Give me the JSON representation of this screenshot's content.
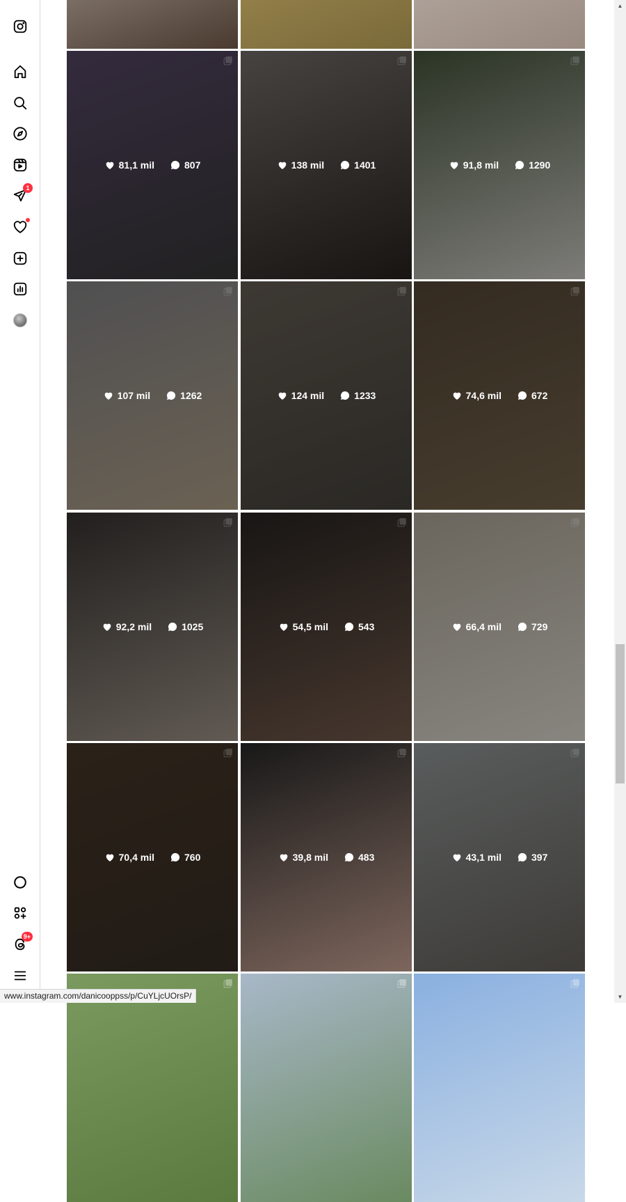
{
  "sidebar": {
    "items": [
      {
        "name": "instagram-logo-icon"
      },
      {
        "name": "home-icon"
      },
      {
        "name": "search-icon"
      },
      {
        "name": "explore-compass-icon"
      },
      {
        "name": "reels-icon"
      },
      {
        "name": "messages-icon",
        "badge": "1"
      },
      {
        "name": "notifications-heart-icon",
        "dot": true
      },
      {
        "name": "create-plus-icon"
      },
      {
        "name": "dashboard-icon"
      },
      {
        "name": "profile-avatar"
      },
      {
        "name": "meta-ai-icon"
      },
      {
        "name": "also-from-meta-icon"
      },
      {
        "name": "threads-icon",
        "badge": "9+"
      },
      {
        "name": "more-menu-icon"
      }
    ],
    "accent_color": "#ff3040"
  },
  "posts": [
    {
      "likes": "",
      "comments": "",
      "colors": [
        "#c9c2b8",
        "#4a3a30"
      ]
    },
    {
      "likes": "",
      "comments": "",
      "colors": [
        "#b8a060",
        "#7a6a3a"
      ]
    },
    {
      "likes": "",
      "comments": "",
      "colors": [
        "#c8c4be",
        "#9a8a80"
      ]
    },
    {
      "likes": "81,1 mil",
      "comments": "807",
      "colors": [
        "#5a4a6a",
        "#3a3a3a"
      ]
    },
    {
      "likes": "138 mil",
      "comments": "1401",
      "colors": [
        "#7a7470",
        "#2a2420"
      ]
    },
    {
      "likes": "91,8 mil",
      "comments": "1290",
      "colors": [
        "#4a5a40",
        "#d8d6d0"
      ]
    },
    {
      "likes": "107 mil",
      "comments": "1262",
      "colors": [
        "#8a8a8c",
        "#b8a890"
      ]
    },
    {
      "likes": "124 mil",
      "comments": "1233",
      "colors": [
        "#6a6258",
        "#4a4640"
      ]
    },
    {
      "likes": "74,6 mil",
      "comments": "672",
      "colors": [
        "#5a4a3a",
        "#7a6a50"
      ]
    },
    {
      "likes": "92,2 mil",
      "comments": "1025",
      "colors": [
        "#3a3634",
        "#a89c90"
      ]
    },
    {
      "likes": "54,5 mil",
      "comments": "543",
      "colors": [
        "#2a2624",
        "#7a6050"
      ]
    },
    {
      "likes": "66,4 mil",
      "comments": "729",
      "colors": [
        "#b8b0a0",
        "#eae6dc"
      ]
    },
    {
      "likes": "70,4 mil",
      "comments": "760",
      "colors": [
        "#4a3a2a",
        "#3a3028"
      ]
    },
    {
      "likes": "39,8 mil",
      "comments": "483",
      "colors": [
        "#2a2a2a",
        "#d8b0a0"
      ]
    },
    {
      "likes": "43,1 mil",
      "comments": "397",
      "colors": [
        "#9aa0a0",
        "#6a6660"
      ]
    },
    {
      "likes": "",
      "comments": "",
      "colors": [
        "#7a9a60",
        "#5a7a40"
      ]
    },
    {
      "likes": "",
      "comments": "",
      "colors": [
        "#a8b8c8",
        "#6a8a60"
      ]
    },
    {
      "likes": "",
      "comments": "",
      "colors": [
        "#8ab0e0",
        "#c8d8e8"
      ]
    }
  ],
  "status_bar": {
    "url": "www.instagram.com/danicooppss/p/CuYLjcUOrsP/"
  }
}
